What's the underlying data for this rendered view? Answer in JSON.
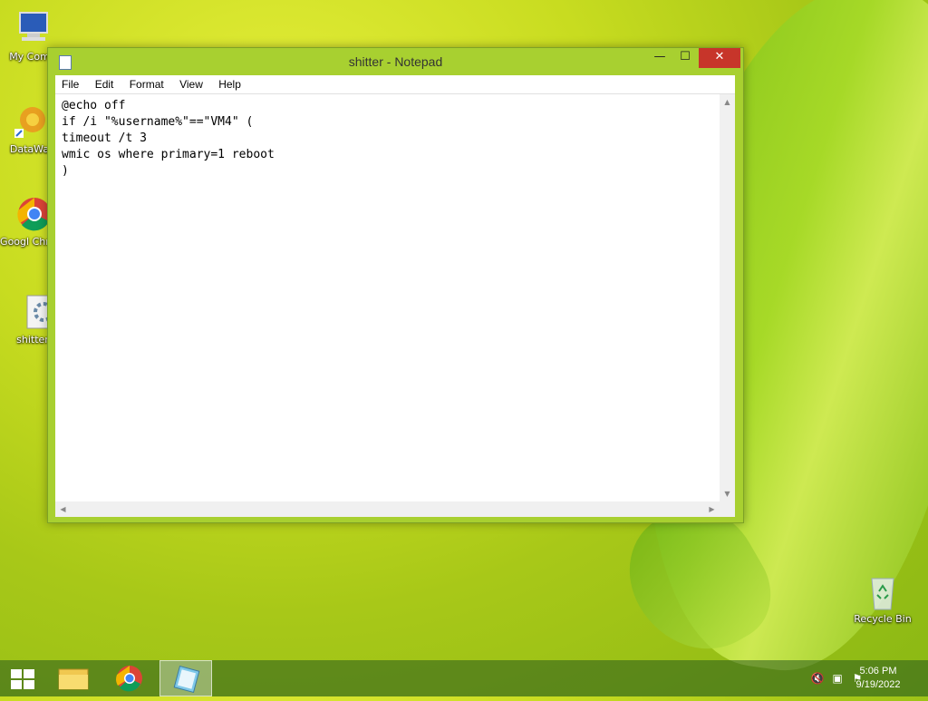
{
  "desktop": {
    "icons": [
      {
        "label": "My Comp",
        "icon": "computer-icon"
      },
      {
        "label": "DataWag",
        "icon": "datawag-icon"
      },
      {
        "label": "Googl Chrom",
        "icon": "chrome-icon"
      },
      {
        "label": "shitter",
        "icon": "batch-file-icon"
      },
      {
        "label": "Recycle Bin",
        "icon": "recycle-bin-icon"
      }
    ]
  },
  "window": {
    "title": "shitter - Notepad",
    "controls": {
      "minimize": "—",
      "maximize": "☐",
      "close": "✕"
    },
    "menu": [
      "File",
      "Edit",
      "Format",
      "View",
      "Help"
    ],
    "content": "@echo off\nif /i \"%username%\"==\"VM4\" (\ntimeout /t 3\nwmic os where primary=1 reboot\n)"
  },
  "taskbar": {
    "items": [
      "start-button",
      "file-explorer",
      "google-chrome",
      "notepad"
    ],
    "clock": {
      "time": "5:06 PM",
      "date": "9/19/2022"
    }
  },
  "colors": {
    "close_button": "#c7352a",
    "window_frame": "#a8d030",
    "taskbar": "#285a1e"
  }
}
